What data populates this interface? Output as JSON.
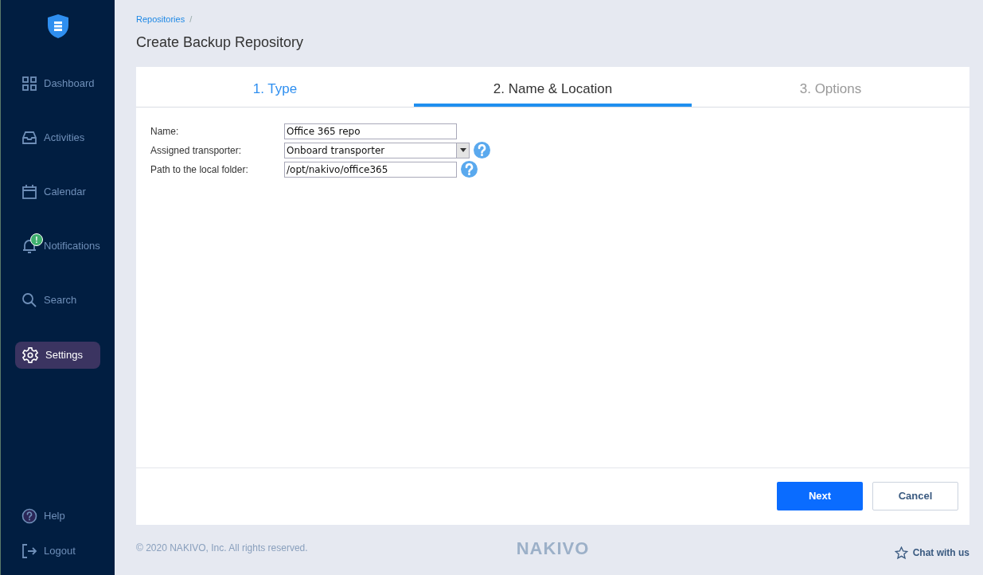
{
  "sidebar": {
    "items": [
      {
        "label": "Dashboard",
        "selected": false
      },
      {
        "label": "Activities",
        "selected": false
      },
      {
        "label": "Calendar",
        "selected": false
      },
      {
        "label": "Notifications",
        "selected": false,
        "badge": "!"
      },
      {
        "label": "Search",
        "selected": false
      },
      {
        "label": "Settings",
        "selected": true
      }
    ],
    "bottom_items": [
      {
        "label": "Help"
      },
      {
        "label": "Logout"
      }
    ]
  },
  "breadcrumb": [
    {
      "label": "Repositories",
      "separator": "/"
    }
  ],
  "title": "Create Backup Repository",
  "steps": [
    {
      "label": "1. Type",
      "selected": false,
      "completed": true
    },
    {
      "label": "2. Name & Location",
      "selected": true,
      "completed": false
    },
    {
      "label": "3. Options",
      "selected": false,
      "completed": false
    }
  ],
  "form": [
    {
      "kind": "text",
      "label": "Name:",
      "value": "Office 365 repo"
    },
    {
      "kind": "select",
      "label": "Assigned transporter:",
      "value": "Onboard transporter",
      "help": true
    },
    {
      "kind": "text",
      "label": "Path to the local folder:",
      "value": "/opt/nakivo/office365",
      "help": true
    }
  ],
  "buttons": [
    {
      "label": "Next",
      "primary": true
    },
    {
      "label": "Cancel",
      "primary": false
    }
  ],
  "footer": {
    "copyright": "© 2020 NAKIVO, Inc. All rights reserved.",
    "logo": "NAKIVO",
    "chat": "Chat with us"
  }
}
